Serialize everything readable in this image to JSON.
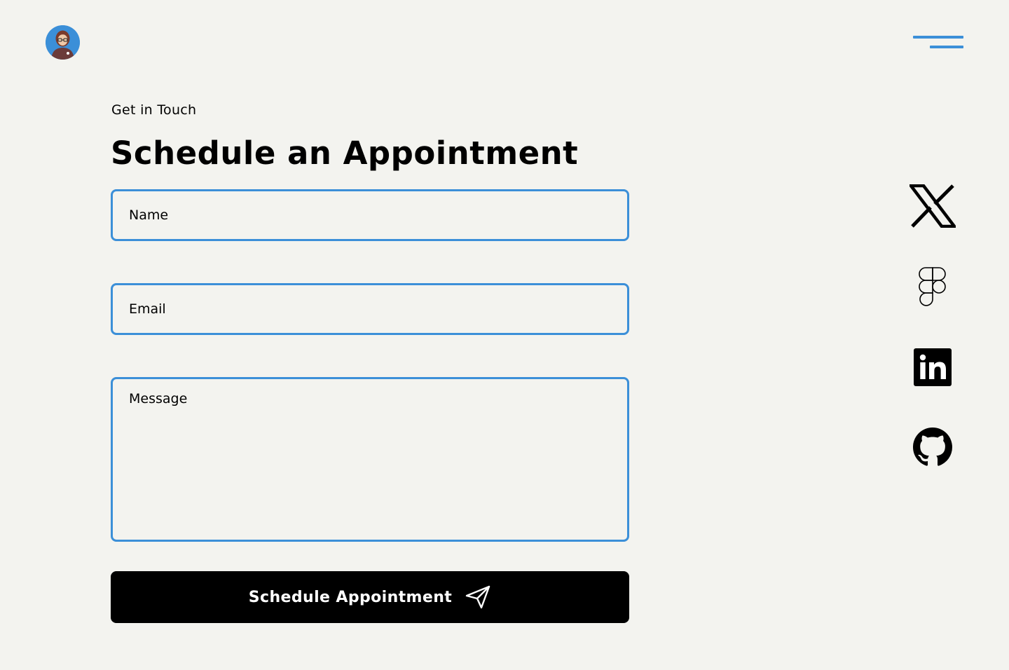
{
  "header": {
    "avatar_icon": "user-avatar",
    "menu_icon": "hamburger-menu-icon"
  },
  "contact": {
    "eyebrow": "Get in Touch",
    "title": "Schedule an Appointment",
    "name_placeholder": "Name",
    "email_placeholder": "Email",
    "message_placeholder": "Message",
    "submit_label": "Schedule Appointment",
    "submit_icon": "send-icon"
  },
  "social": [
    {
      "icon": "x-icon"
    },
    {
      "icon": "figma-icon"
    },
    {
      "icon": "linkedin-icon"
    },
    {
      "icon": "github-icon"
    }
  ],
  "colors": {
    "background": "#f3f3ef",
    "accent": "#3b8fd8",
    "button": "#000000",
    "button_text": "#ffffff"
  }
}
